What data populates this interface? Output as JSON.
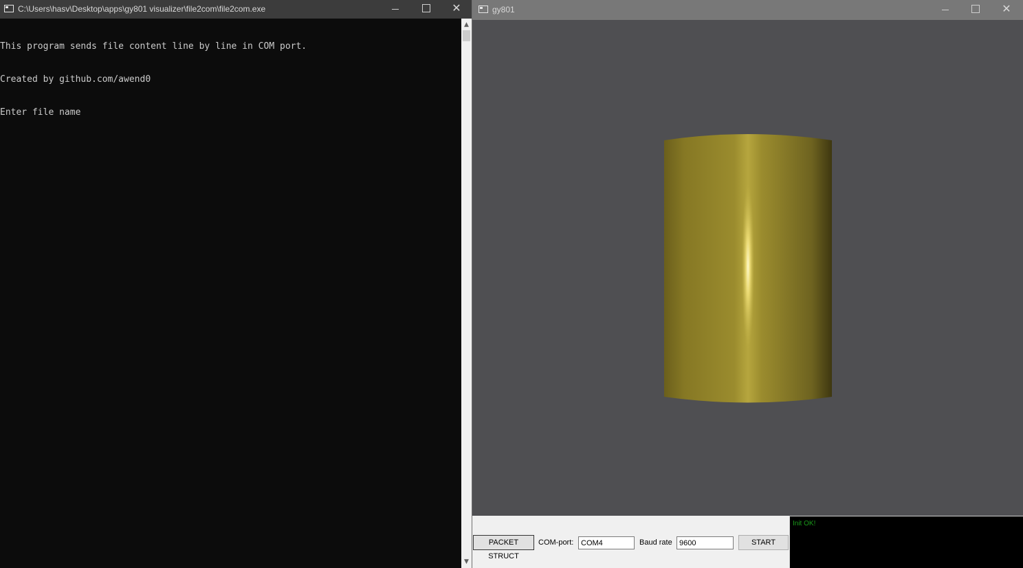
{
  "console_window": {
    "title": "C:\\Users\\hasv\\Desktop\\apps\\gy801 visualizer\\file2com\\file2com.exe",
    "lines": [
      "This program sends file content line by line in COM port.",
      "Created by github.com/awend0",
      "Enter file name"
    ],
    "controls": {
      "minimize": "",
      "maximize": "",
      "close": "✕"
    },
    "scrollbar": {
      "up": "▲",
      "down": "▼"
    },
    "colors": {
      "background": "#0c0c0c",
      "text": "#cccccc"
    }
  },
  "viz_window": {
    "title": "gy801",
    "controls": {
      "minimize": "",
      "maximize": "",
      "close": "✕"
    },
    "viewport": {
      "object": "cylinder",
      "object_color": "#9a8b2c",
      "background": "#4f4f52"
    },
    "toolbar": {
      "packet_struct_label": "PACKET STRUCT",
      "com_port_label": "COM-port:",
      "com_port_value": "COM4",
      "baud_rate_label": "Baud rate",
      "baud_rate_value": "9600",
      "start_label": "START"
    },
    "log": {
      "text": "Init OK!",
      "text_color": "#1a9a1a"
    }
  }
}
